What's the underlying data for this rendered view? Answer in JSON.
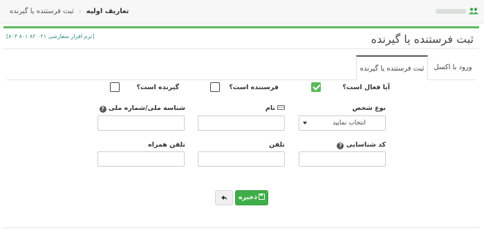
{
  "topbar": {
    "breadcrumb": [
      "تعاریف اولیه",
      "ثبت فرستنده یا گیرنده"
    ],
    "separator": "‹"
  },
  "panel": {
    "title": "ثبت فرستنده یا گیرنده",
    "support": "[نرم افزار سفارشی ۰۲۱ ۸۲ ۸۰۱ ۸۰۳]"
  },
  "tabs": [
    {
      "label": "ورود با اکسل",
      "active": false
    },
    {
      "label": "ثبت فرستنده یا گیرنده",
      "active": true
    }
  ],
  "form": {
    "is_active": {
      "label": "آیا فعال است؟",
      "checked": true
    },
    "is_sender": {
      "label": "فرستنده است؟",
      "checked": false
    },
    "is_receiver": {
      "label": "گیرنده است؟",
      "checked": false
    },
    "person_type": {
      "label": "نوع شخص",
      "value": "انتخاب نمایید"
    },
    "name": {
      "label": "نام",
      "value": ""
    },
    "national_id": {
      "label": "شناسه ملی/شماره ملی",
      "value": ""
    },
    "code": {
      "label": "کد شناسایی",
      "value": ""
    },
    "phone": {
      "label": "تلفن",
      "value": ""
    },
    "mobile": {
      "label": "تلفن همراه",
      "value": ""
    },
    "help_glyph": "?"
  },
  "buttons": {
    "save": "ذخیره",
    "back_icon": "arrow-back-icon"
  },
  "colors": {
    "accent": "#5cb85c",
    "save_button": "#3fae49"
  }
}
